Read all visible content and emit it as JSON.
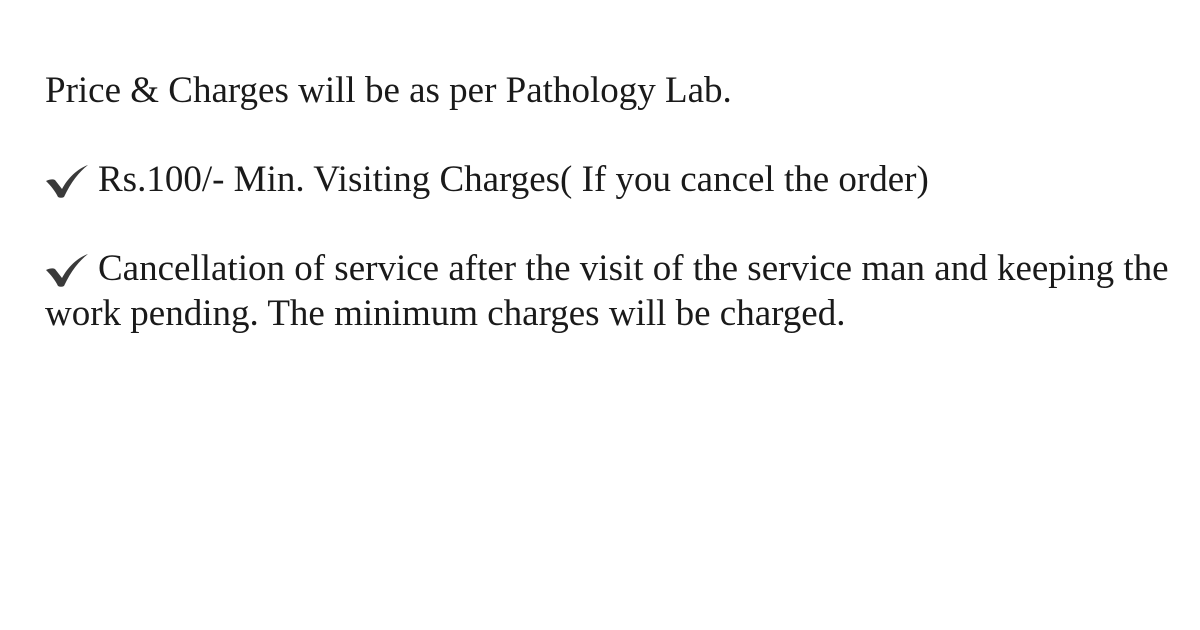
{
  "document": {
    "intro": "Price & Charges will be as per Pathology Lab.",
    "items": [
      {
        "icon": "check-icon",
        "text": "Rs.100/- Min. Visiting Charges( If you cancel the order)"
      },
      {
        "icon": "check-icon",
        "text": "Cancellation of service after the visit of the service man and keeping the work pending. The minimum charges will be charged."
      }
    ]
  },
  "colors": {
    "text": "#1a1a1a",
    "checkmark": "#3a3a3a",
    "background": "#ffffff"
  }
}
